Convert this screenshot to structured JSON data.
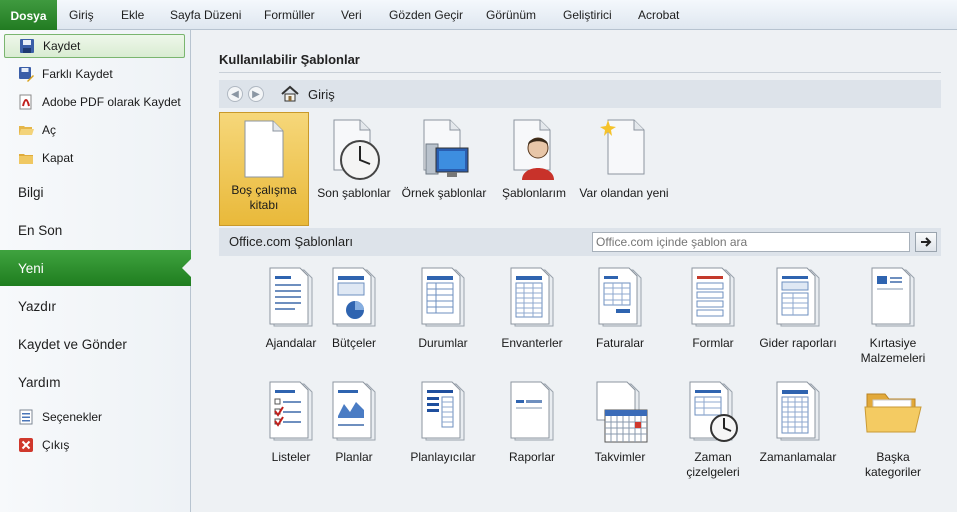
{
  "ribbon": {
    "file_tab": "Dosya",
    "tabs": [
      "Giriş",
      "Ekle",
      "Sayfa Düzeni",
      "Formüller",
      "Veri",
      "Gözden Geçir",
      "Görünüm",
      "Geliştirici",
      "Acrobat"
    ]
  },
  "sidebar": {
    "commands": [
      {
        "label": "Kaydet",
        "icon": "save-icon"
      },
      {
        "label": "Farklı Kaydet",
        "icon": "save-as-icon"
      },
      {
        "label": "Adobe PDF olarak Kaydet",
        "icon": "pdf-icon"
      },
      {
        "label": "Aç",
        "icon": "open-folder-icon"
      },
      {
        "label": "Kapat",
        "icon": "close-folder-icon"
      }
    ],
    "sections": [
      "Bilgi",
      "En Son",
      "Yeni",
      "Yazdır",
      "Kaydet ve Gönder",
      "Yardım"
    ],
    "active_section": "Yeni",
    "bottom": [
      {
        "label": "Seçenekler",
        "icon": "options-icon"
      },
      {
        "label": "Çıkış",
        "icon": "exit-icon"
      }
    ]
  },
  "main": {
    "heading": "Kullanılabilir Şablonlar",
    "nav": {
      "location": "Giriş"
    },
    "local_templates": [
      {
        "label": "Boş çalışma kitabı",
        "icon": "blank-workbook-icon",
        "selected": true
      },
      {
        "label": "Son şablonlar",
        "icon": "recent-templates-clock-icon"
      },
      {
        "label": "Örnek şablonlar",
        "icon": "sample-templates-icon"
      },
      {
        "label": "Şablonlarım",
        "icon": "my-templates-user-icon"
      },
      {
        "label": "Var olandan yeni",
        "icon": "new-from-existing-icon"
      }
    ],
    "office_section": {
      "label": "Office.com Şablonları",
      "search_placeholder": "Office.com içinde şablon ara"
    },
    "categories": [
      {
        "label": "Ajandalar",
        "icon": "agenda-doc-icon"
      },
      {
        "label": "Bütçeler",
        "icon": "budget-doc-icon"
      },
      {
        "label": "Durumlar",
        "icon": "status-doc-icon"
      },
      {
        "label": "Envanterler",
        "icon": "inventory-doc-icon"
      },
      {
        "label": "Faturalar",
        "icon": "invoice-doc-icon"
      },
      {
        "label": "Formlar",
        "icon": "form-doc-icon"
      },
      {
        "label": "Gider raporları",
        "icon": "expense-report-doc-icon"
      },
      {
        "label": "Kırtasiye Malzemeleri",
        "icon": "stationery-doc-icon"
      },
      {
        "label": "Listeler",
        "icon": "list-doc-icon"
      },
      {
        "label": "Planlar",
        "icon": "plan-doc-icon"
      },
      {
        "label": "Planlayıcılar",
        "icon": "planner-doc-icon"
      },
      {
        "label": "Raporlar",
        "icon": "report-doc-icon"
      },
      {
        "label": "Takvimler",
        "icon": "calendar-doc-icon"
      },
      {
        "label": "Zaman çizelgeleri",
        "icon": "timesheet-doc-icon"
      },
      {
        "label": "Zamanlamalar",
        "icon": "schedule-doc-icon"
      },
      {
        "label": "Başka kategoriler",
        "icon": "folder-icon"
      }
    ]
  }
}
